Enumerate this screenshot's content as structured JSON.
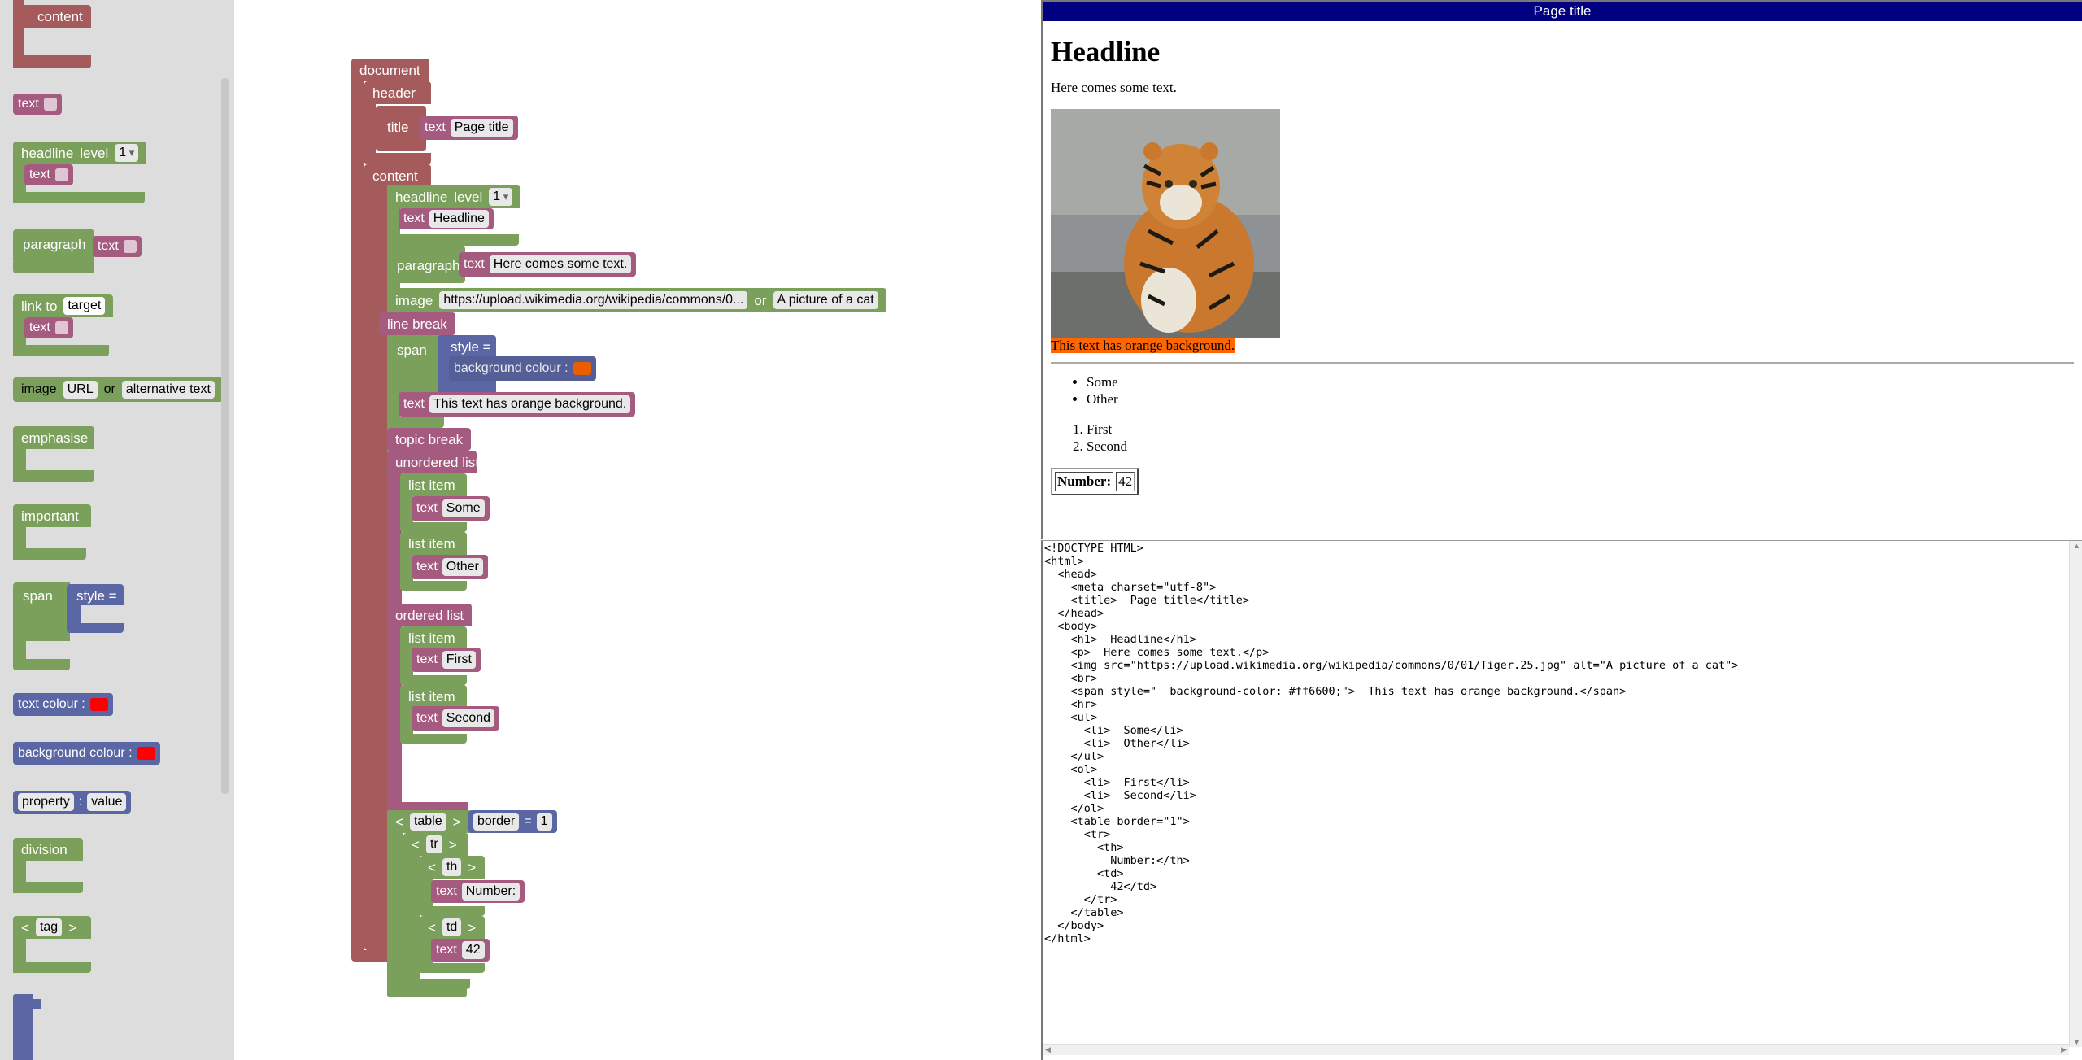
{
  "toolbox": {
    "content_label": "content",
    "text_label": "text",
    "headline_label": "headline",
    "level_label": "level",
    "level_value": "1",
    "paragraph_label": "paragraph",
    "link_label": "link to",
    "link_target": "target",
    "image_label": "image",
    "image_url": "URL",
    "image_or": "or",
    "image_alt": "alternative text",
    "emphasise_label": "emphasise",
    "important_label": "important",
    "span_label": "span",
    "style_label": "style =",
    "text_colour_label": "text colour :",
    "text_colour_value": "#ff0000",
    "background_colour_label": "background colour :",
    "background_colour_value": "#ff0000",
    "property_label": "property",
    "property_sep": ":",
    "value_label": "value",
    "division_label": "division",
    "tag_open": "<",
    "tag_label": "tag",
    "tag_close": ">"
  },
  "workspace": {
    "document_label": "document",
    "header_label": "header",
    "title_label": "title",
    "text_label": "text",
    "title_value": "Page title",
    "content_label": "content",
    "headline_label": "headline",
    "level_label": "level",
    "level_value": "1",
    "headline_value": "Headline",
    "paragraph_label": "paragraph",
    "paragraph_value": "Here comes some text.",
    "image_label": "image",
    "image_url": "https://upload.wikimedia.org/wikipedia/commons/0...",
    "image_or": "or",
    "image_alt": "A picture of a cat",
    "line_break_label": "line break",
    "span_label": "span",
    "style_label": "style =",
    "bg_colour_label": "background colour :",
    "bg_colour_value": "#ff6600",
    "span_text": "This text has orange background.",
    "topic_break_label": "topic break",
    "unordered_list_label": "unordered list",
    "list_item_label": "list item",
    "ul_items": [
      "Some",
      "Other"
    ],
    "ordered_list_label": "ordered list",
    "ol_items": [
      "First",
      "Second"
    ],
    "lt": "<",
    "gt": ">",
    "table_tag": "table",
    "border_attr": "border",
    "eq": "=",
    "border_value": "1",
    "tr_tag": "tr",
    "th_tag": "th",
    "th_text": "Number:",
    "td_tag": "td",
    "td_text": "42"
  },
  "preview": {
    "title": "Page title",
    "headline": "Headline",
    "paragraph": "Here comes some text.",
    "image_alt": "A picture of a cat",
    "span_text": "This text has orange background.",
    "span_bg": "#ff6600",
    "ul_items": [
      "Some",
      "Other"
    ],
    "ol_items": [
      "First",
      "Second"
    ],
    "table_th": "Number:",
    "table_td": "42"
  },
  "source": {
    "code": "<!DOCTYPE HTML>\n<html>\n  <head>\n    <meta charset=\"utf-8\">\n    <title>  Page title</title>\n  </head>\n  <body>\n    <h1>  Headline</h1>\n    <p>  Here comes some text.</p>\n    <img src=\"https://upload.wikimedia.org/wikipedia/commons/0/01/Tiger.25.jpg\" alt=\"A picture of a cat\">\n    <br>\n    <span style=\"  background-color: #ff6600;\">  This text has orange background.</span>\n    <hr>\n    <ul>\n      <li>  Some</li>\n      <li>  Other</li>\n    </ul>\n    <ol>\n      <li>  First</li>\n      <li>  Second</li>\n    </ol>\n    <table border=\"1\">\n      <tr>\n        <th>\n          Number:</th>\n        <td>\n          42</td>\n      </tr>\n    </table>\n  </body>\n</html>"
  }
}
